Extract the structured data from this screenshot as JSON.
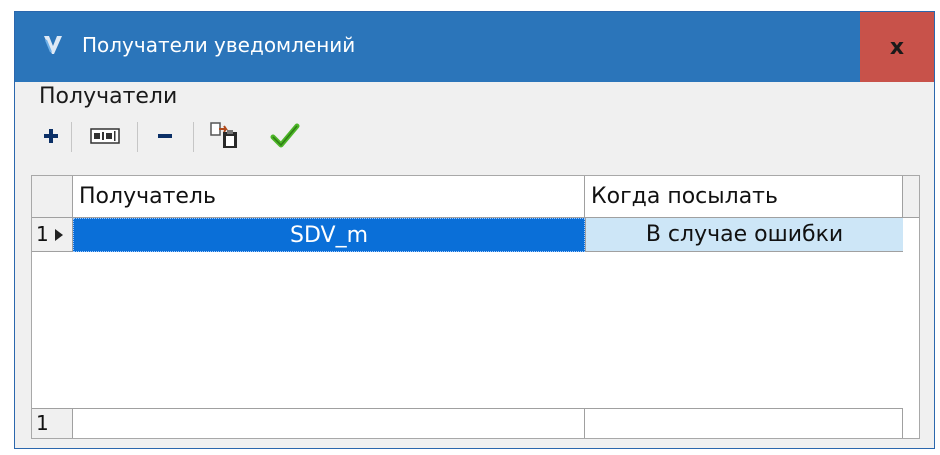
{
  "window": {
    "title": "Получатели уведомлений",
    "close_label": "x"
  },
  "section": {
    "label": "Получатели"
  },
  "toolbar": {
    "add_icon": "plus-icon",
    "edit_icon": "text-field-icon",
    "remove_icon": "minus-icon",
    "paste_icon": "paste-icon",
    "apply_icon": "checkmark-icon"
  },
  "grid": {
    "columns": [
      "Получатель",
      "Когда посылать"
    ],
    "rows": [
      {
        "index": "1",
        "recipient": "SDV_m",
        "when": "В случае ошибки"
      }
    ],
    "footer_count": "1"
  },
  "colors": {
    "title_bar": "#2b75ba",
    "close": "#c8524a",
    "selection": "#0a6fd8",
    "cell_highlight": "#cde6f7"
  }
}
